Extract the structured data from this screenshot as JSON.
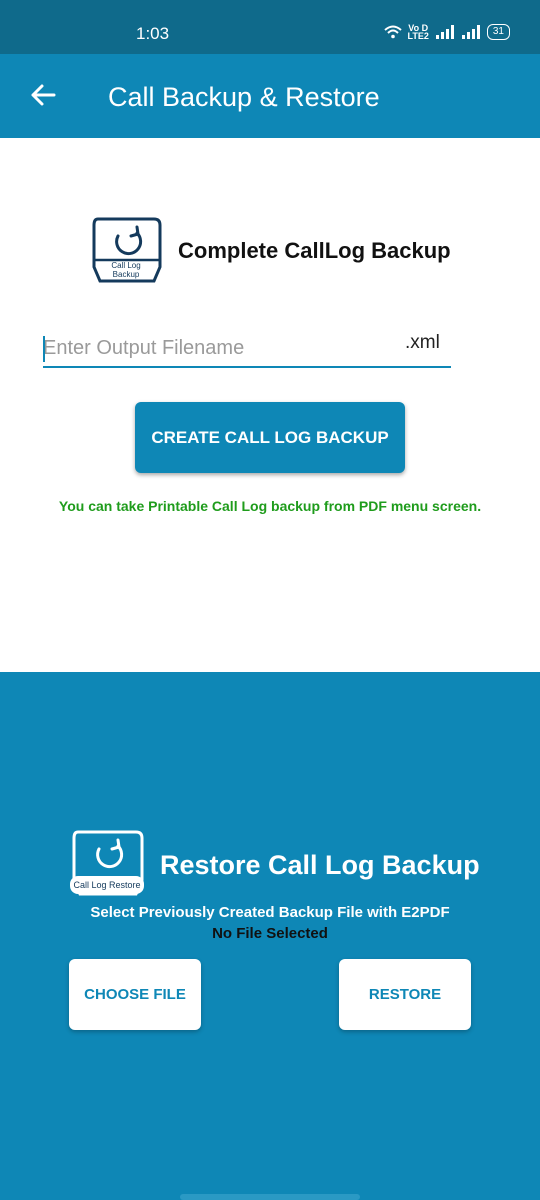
{
  "status_bar": {
    "time": "1:03",
    "volte_label": "Vo D\nLTE2",
    "battery": "31"
  },
  "app_bar": {
    "title": "Call Backup & Restore",
    "back_icon": "arrow-left-icon"
  },
  "backup": {
    "logo_label_line1": "Call Log",
    "logo_label_line2": "Backup",
    "title": "Complete CallLog Backup",
    "filename_placeholder": "Enter Output Filename",
    "filename_value": "",
    "extension": ".xml",
    "create_button": "CREATE CALL LOG BACKUP",
    "pdf_note": "You can take Printable Call Log backup from PDF menu screen."
  },
  "restore": {
    "logo_label": "Call Log Restore",
    "title": "Restore Call Log Backup",
    "subtitle": "Select Previously Created Backup File with E2PDF",
    "file_status": "No File Selected",
    "choose_button": "CHOOSE FILE",
    "restore_button": "RESTORE"
  },
  "colors": {
    "status_bar": "#0f6a8b",
    "primary": "#0e87b6",
    "note_green": "#1f9c1c"
  }
}
